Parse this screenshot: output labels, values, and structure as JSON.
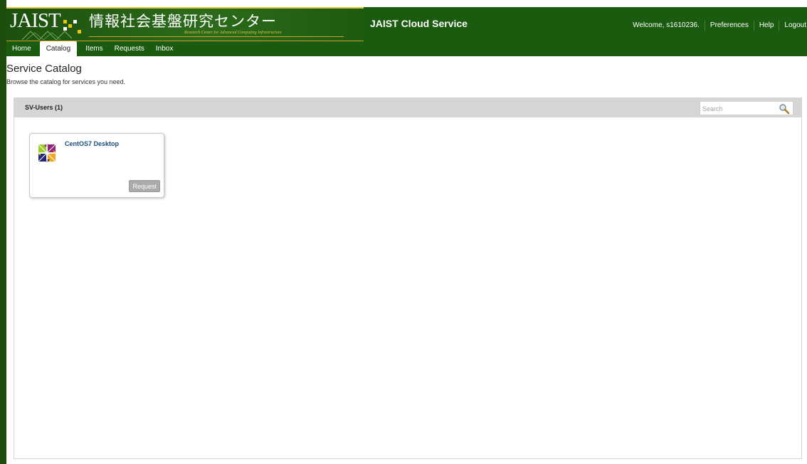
{
  "header": {
    "logo_text": "JAIST",
    "org_title_jp": "情報社会基盤研究センター",
    "org_subtitle_en": "Research Center for Advanced Computing Infrastructure",
    "app_title": "JAIST Cloud Service",
    "colors": {
      "header_bg": "#1b5b10",
      "gold": "#c9a227",
      "left_rule": "#1d4d0c"
    }
  },
  "user_nav": {
    "welcome": "Welcome, s1610236.",
    "preferences": "Preferences",
    "help": "Help",
    "logout": "Logout"
  },
  "tabs": [
    {
      "label": "Home",
      "active": false
    },
    {
      "label": "Catalog",
      "active": true
    },
    {
      "label": "Items",
      "active": false
    },
    {
      "label": "Requests",
      "active": false
    },
    {
      "label": "Inbox",
      "active": false
    }
  ],
  "page": {
    "title": "Service Catalog",
    "description": "Browse the catalog for services you need."
  },
  "catalog": {
    "group_title": "SV-Users (1)",
    "search_placeholder": "Search",
    "search_icon": "magnifier-icon",
    "items": [
      {
        "title": "CentOS7 Desktop",
        "icon": "centos-logo-icon",
        "button_label": "Request"
      }
    ]
  }
}
